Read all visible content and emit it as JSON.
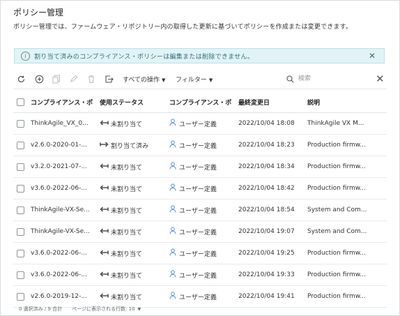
{
  "page": {
    "title": "ポリシー管理",
    "description": "ポリシー管理では、ファームウェア・リポジトリー内の取得した更新に基づいてポリシーを作成または変更できます。"
  },
  "alert": {
    "message": "割り当て済みのコンプライアンス・ポリシーは編集または削除できません。"
  },
  "toolbar": {
    "all_actions": "すべての操作",
    "filter": "フィルター",
    "search_placeholder": "検索"
  },
  "table": {
    "headers": {
      "policy": "コンプライアンス・ポ",
      "usage": "使用ステータス",
      "source": "コンプライアンス・ポ",
      "modified": "最終変更日",
      "description": "説明"
    },
    "rows": [
      {
        "name": "ThinkAgile_VX_0...",
        "status": "未割り当て",
        "assigned": false,
        "source": "ユーザー定義",
        "date": "2022/10/04 18:08",
        "desc": "ThinkAgile VX M..."
      },
      {
        "name": "v2.6.0-2020-01-...",
        "status": "割り当て済み",
        "assigned": true,
        "source": "ユーザー定義",
        "date": "2022/10/04 18:23",
        "desc": "Production firmw..."
      },
      {
        "name": "v3.2.0-2021-07-...",
        "status": "未割り当て",
        "assigned": false,
        "source": "ユーザー定義",
        "date": "2022/10/04 18:34",
        "desc": "Production firmw..."
      },
      {
        "name": "v3.6.0-2022-06-...",
        "status": "未割り当て",
        "assigned": false,
        "source": "ユーザー定義",
        "date": "2022/10/04 18:42",
        "desc": "Production firmw..."
      },
      {
        "name": "ThinkAgile-VX-Se...",
        "status": "未割り当て",
        "assigned": false,
        "source": "ユーザー定義",
        "date": "2022/10/04 18:54",
        "desc": "System and Com..."
      },
      {
        "name": "ThinkAgile-VX-Se...",
        "status": "未割り当て",
        "assigned": false,
        "source": "ユーザー定義",
        "date": "2022/10/04 19:07",
        "desc": "System and Com..."
      },
      {
        "name": "v3.6.0-2022-06-...",
        "status": "未割り当て",
        "assigned": false,
        "source": "ユーザー定義",
        "date": "2022/10/04 19:25",
        "desc": "Production firmw..."
      },
      {
        "name": "v3.6.0-2022-06-...",
        "status": "未割り当て",
        "assigned": false,
        "source": "ユーザー定義",
        "date": "2022/10/04 19:33",
        "desc": "Production firmw..."
      },
      {
        "name": "v2.6.0-2019-12-...",
        "status": "未割り当て",
        "assigned": false,
        "source": "ユーザー定義",
        "date": "2022/10/04 19:41",
        "desc": "Production firmw..."
      }
    ]
  },
  "footer": {
    "selection": "0 選択済み / 9 合計",
    "per_page_label": "ページに表示される行数: 10"
  },
  "colors": {
    "alert_bg": "#e1f3f6",
    "alert_text": "#2f6f7a",
    "user_icon": "#4a8fd4"
  },
  "icons": [
    "refresh-icon",
    "add-icon",
    "copy-icon",
    "edit-icon",
    "export-icon",
    "search-icon",
    "close-icon",
    "info-icon",
    "user-icon",
    "unassigned-icon",
    "assigned-icon"
  ]
}
